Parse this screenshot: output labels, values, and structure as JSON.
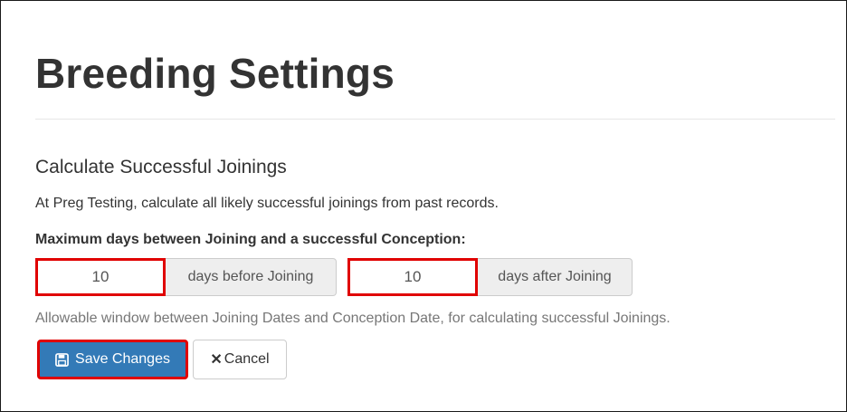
{
  "page": {
    "title": "Breeding Settings"
  },
  "section": {
    "title": "Calculate Successful Joinings",
    "description": "At Preg Testing, calculate all likely successful joinings from past records.",
    "field_label": "Maximum days between Joining and a successful Conception:",
    "days_before": {
      "value": "10",
      "addon": "days before Joining"
    },
    "days_after": {
      "value": "10",
      "addon": "days after Joining"
    },
    "help_text": "Allowable window between Joining Dates and Conception Date, for calculating successful Joinings."
  },
  "actions": {
    "save_label": "Save Changes",
    "save_icon": "floppy-disk-icon",
    "cancel_label": "Cancel",
    "cancel_icon": "x-icon"
  },
  "colors": {
    "primary": "#337ab7",
    "highlight": "#e00000",
    "addon_bg": "#eeeeee"
  }
}
